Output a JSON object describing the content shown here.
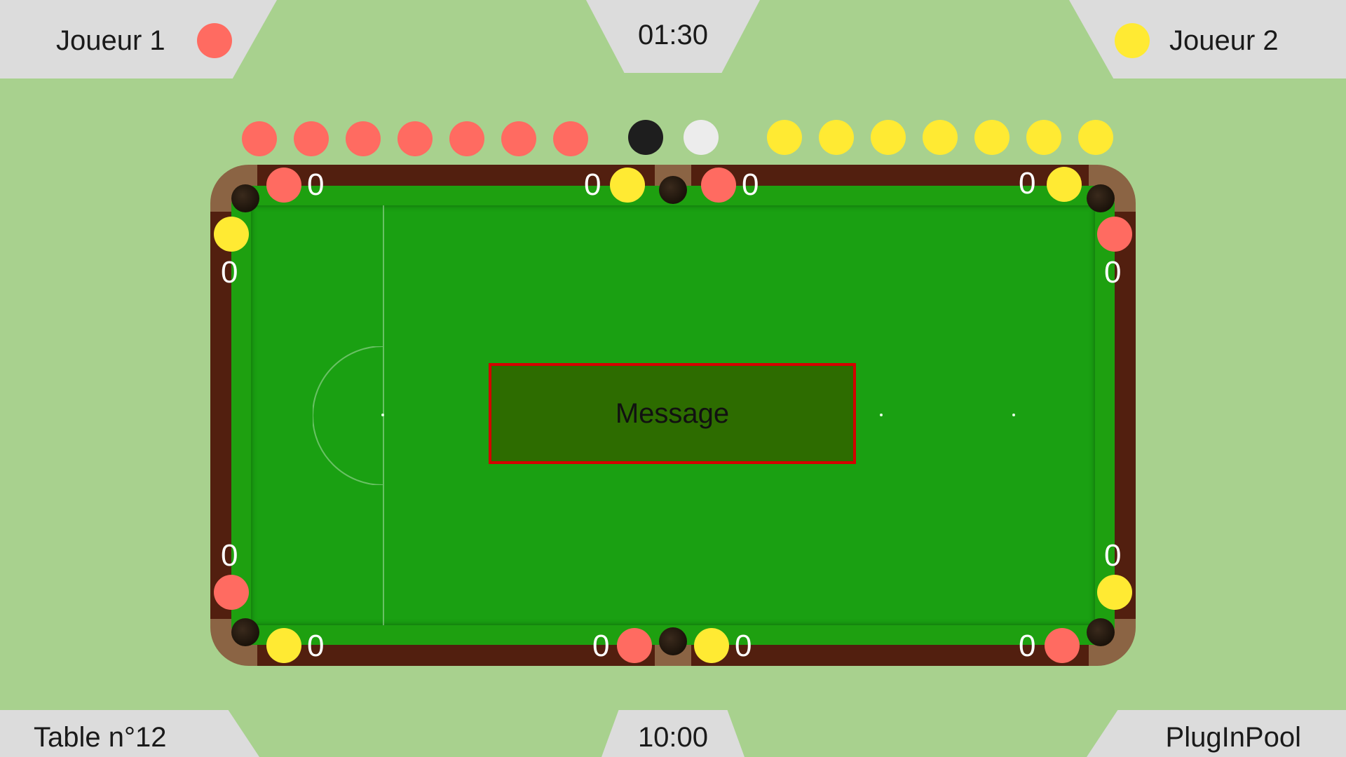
{
  "header": {
    "player1": {
      "name": "Joueur 1",
      "color": "#ff6b61"
    },
    "player2": {
      "name": "Joueur 2",
      "color": "#ffea33"
    },
    "timer": "01:30"
  },
  "footer": {
    "table_label": "Table n°12",
    "clock": "10:00",
    "brand": "PlugInPool"
  },
  "remaining_balls": {
    "player1": {
      "count": 7,
      "color": "#ff6b61"
    },
    "black": "#1e1e1e",
    "cue": "#ececec",
    "player2": {
      "count": 7,
      "color": "#ffea33"
    }
  },
  "message": "Message",
  "pockets": {
    "top_left": [
      "0",
      "0"
    ],
    "top_center": [
      "0",
      "0"
    ],
    "top_right": [
      "0",
      "0"
    ],
    "bottom_left": [
      "0",
      "0"
    ],
    "bottom_center": [
      "0",
      "0"
    ],
    "bottom_right": [
      "0",
      "0"
    ]
  },
  "colors": {
    "background": "#a8d18e",
    "panel": "#dcdcdc",
    "felt": "#1aa012",
    "rail": "#521f0f",
    "table_frame": "#8b6444",
    "message_bg": "#2d6c00",
    "message_border": "#d40000"
  }
}
